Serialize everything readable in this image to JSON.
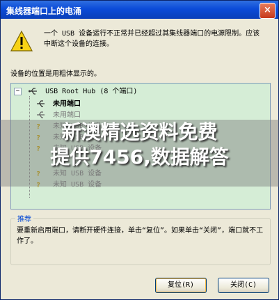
{
  "window": {
    "title": "集线器端口上的电涌"
  },
  "icons": {
    "warning": "warning-icon",
    "usb": "usb-icon",
    "close": "close-icon"
  },
  "message": {
    "text": "一个 USB 设备运行不正常并已经超过其集线器端口的电源限制。应该中断这个设备的连接。"
  },
  "subhead": "设备的位置是用粗体显示的。",
  "tree": {
    "root": "USB Root Hub (8 个端口)",
    "items": [
      {
        "label": "未用端口",
        "bold": true
      },
      {
        "label": "未用端口",
        "bold": false
      },
      {
        "label": "未知 USB 设备",
        "bold": false
      },
      {
        "label": "未知 USB 设备",
        "bold": false
      },
      {
        "label": "未知 USB 设备",
        "bold": false
      },
      {
        "label": "未知 USB 设备",
        "bold": false
      },
      {
        "label": "未知 USB 设备",
        "bold": false
      }
    ]
  },
  "overlay": {
    "line1": "新澳精选资料免费",
    "line2": "提供7456,数据解答"
  },
  "recommendation": {
    "legend": "推荐",
    "text": "要重新启用端口，请断开硬件连接，单击“复位”。如果单击“关闭”，端口就不工作了。"
  },
  "buttons": {
    "reset": "复位(R)",
    "close": "关闭(C)"
  },
  "colors": {
    "title_bar": "#0b4bd8",
    "tree_bg": "#d5edd6",
    "legend": "#0046d5"
  }
}
